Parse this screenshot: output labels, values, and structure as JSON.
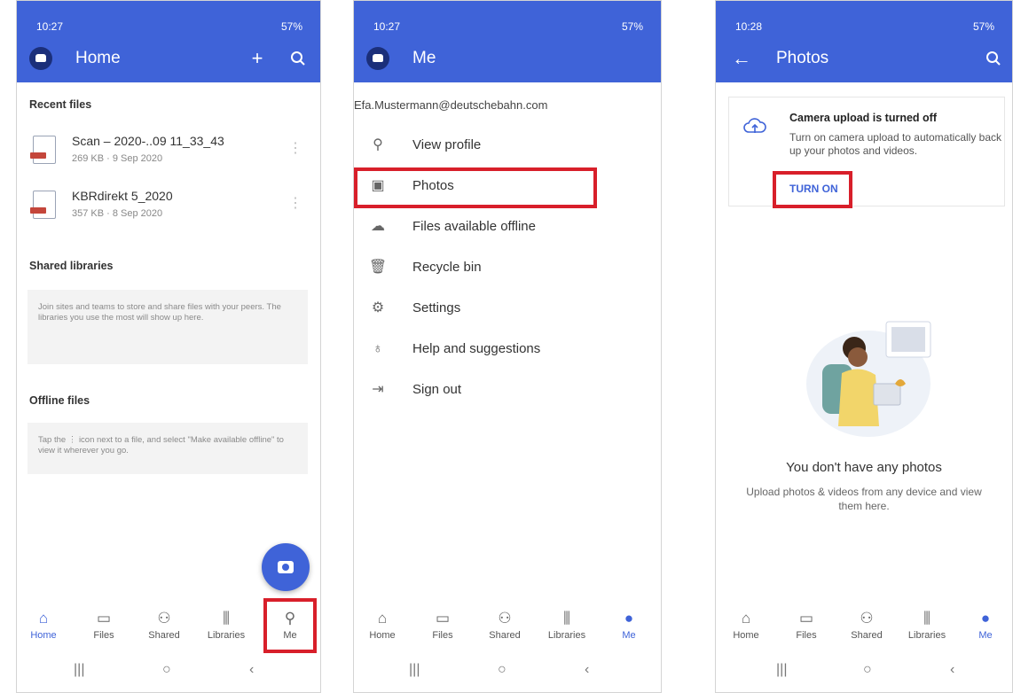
{
  "phones": [
    {
      "status": {
        "time": "10:27",
        "right": "57%"
      },
      "appbar": {
        "title": "Home"
      },
      "recent": {
        "heading": "Recent files",
        "files": [
          {
            "name": "Scan – 2020-..09 11_33_43",
            "meta": "269 KB · 9 Sep 2020"
          },
          {
            "name": "KBRdirekt 5_2020",
            "meta": "357 KB · 8 Sep 2020"
          }
        ]
      },
      "shared": {
        "heading": "Shared libraries",
        "body": "Join sites and teams to store and share files with your peers. The libraries you use the most will show up here."
      },
      "offline": {
        "heading": "Offline files",
        "body": "Tap the ⋮ icon next to a file, and select \"Make available offline\" to view it wherever you go."
      },
      "nav": [
        "Home",
        "Files",
        "Shared",
        "Libraries",
        "Me"
      ]
    },
    {
      "status": {
        "time": "10:27",
        "right": "57%"
      },
      "appbar": {
        "title": "Me"
      },
      "email": "Efa.Mustermann@deutschebahn.com",
      "menu": [
        "View profile",
        "Photos",
        "Files available offline",
        "Recycle bin",
        "Settings",
        "Help and suggestions",
        "Sign out"
      ],
      "nav": [
        "Home",
        "Files",
        "Shared",
        "Libraries",
        "Me"
      ]
    },
    {
      "status": {
        "time": "10:28",
        "right": "57%"
      },
      "appbar": {
        "title": "Photos"
      },
      "card": {
        "title": "Camera upload is turned off",
        "body": "Turn on camera upload to automatically back up your photos and videos.",
        "action": "TURN ON"
      },
      "empty": {
        "title": "You don't have any photos",
        "subtitle": "Upload photos & videos from any device and view them here."
      },
      "nav": [
        "Home",
        "Files",
        "Shared",
        "Libraries",
        "Me"
      ]
    }
  ]
}
